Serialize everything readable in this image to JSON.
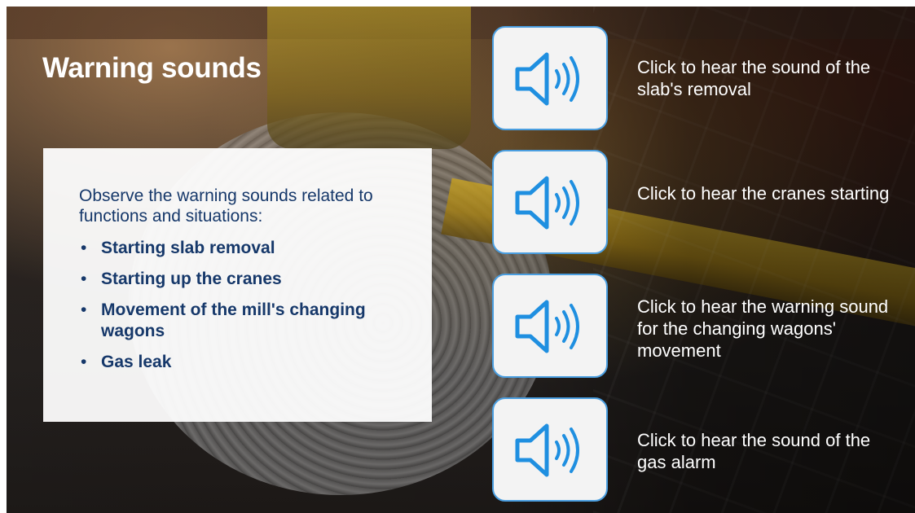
{
  "slide": {
    "title": "Warning sounds",
    "intro": "Observe the warning sounds related to functions and situations:",
    "bullet_symbol": "•",
    "bullets": [
      "Starting slab removal",
      "Starting up the cranes",
      "Movement of the mill's changing wagons",
      "Gas leak"
    ]
  },
  "sound_buttons": [
    {
      "icon": "speaker-icon",
      "label": "Click to hear the sound of the slab's removal"
    },
    {
      "icon": "speaker-icon",
      "label": "Click to hear the cranes starting"
    },
    {
      "icon": "speaker-icon",
      "label": "Click to hear the warning sound for the changing wagons' movement"
    },
    {
      "icon": "speaker-icon",
      "label": "Click to hear the sound of the gas alarm"
    }
  ],
  "colors": {
    "title_text": "#ffffff",
    "box_text": "#16386a",
    "icon_accent": "#1f8fe0",
    "button_border": "#4a9ee0"
  }
}
